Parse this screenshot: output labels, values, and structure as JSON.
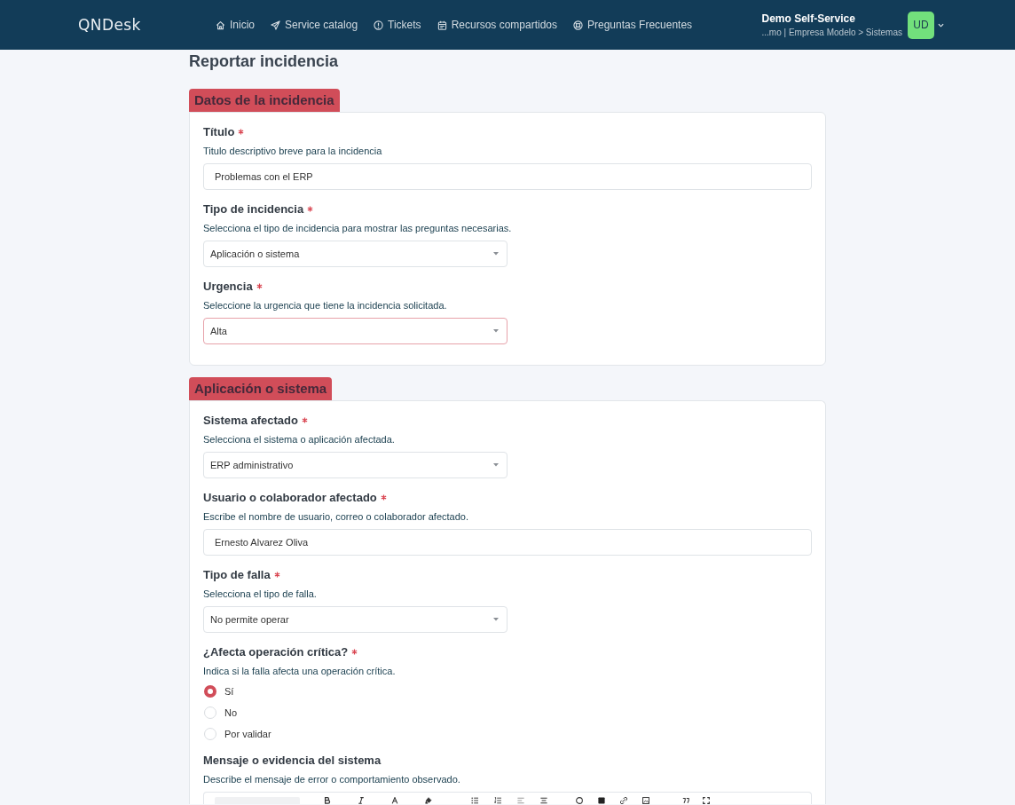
{
  "header": {
    "logo": "QNDesk",
    "nav": [
      {
        "label": "Inicio"
      },
      {
        "label": "Service catalog"
      },
      {
        "label": "Tickets"
      },
      {
        "label": "Recursos compartidos"
      },
      {
        "label": "Preguntas Frecuentes"
      }
    ],
    "user": {
      "name": "Demo Self-Service",
      "context": "...mo | Empresa Modelo > Sistemas",
      "initials": "UD"
    }
  },
  "page_title": "Reportar incidencia",
  "sections": [
    {
      "title": "Datos de la incidencia",
      "fields": [
        {
          "kind": "text",
          "label": "Título",
          "required": true,
          "help": "Titulo descriptivo breve para la incidencia",
          "value": "Problemas con el ERP",
          "focused": false
        },
        {
          "kind": "select",
          "label": "Tipo de incidencia",
          "required": true,
          "help": "Selecciona el tipo de incidencia para mostrar las preguntas necesarias.",
          "value": "Aplicación o sistema",
          "focused": false
        },
        {
          "kind": "select",
          "label": "Urgencia",
          "required": true,
          "help": "Seleccione la urgencia que tiene la incidencia solicitada.",
          "value": "Alta",
          "focused": true
        }
      ]
    },
    {
      "title": "Aplicación o sistema",
      "fields": [
        {
          "kind": "select",
          "label": "Sistema afectado",
          "required": true,
          "help": "Selecciona el sistema o aplicación afectada.",
          "value": "ERP administrativo",
          "focused": false
        },
        {
          "kind": "text",
          "label": "Usuario o colaborador afectado",
          "required": true,
          "help": "Escribe el nombre de usuario, correo o colaborador afectado.",
          "value": "Ernesto Alvarez Oliva",
          "focused": false
        },
        {
          "kind": "select",
          "label": "Tipo de falla",
          "required": true,
          "help": "Selecciona el tipo de falla.",
          "value": "No permite operar",
          "focused": false
        },
        {
          "kind": "radio",
          "label": "¿Afecta operación crítica?",
          "required": true,
          "help": "Indica si la falla afecta una operación crítica.",
          "options": [
            {
              "label": "Sí",
              "selected": true
            },
            {
              "label": "No",
              "selected": false
            },
            {
              "label": "Por validar",
              "selected": false
            }
          ]
        },
        {
          "kind": "editor",
          "label": "Mensaje o evidencia del sistema",
          "required": false,
          "help": "Describe el mensaje de error o comportamiento observado."
        }
      ]
    }
  ]
}
